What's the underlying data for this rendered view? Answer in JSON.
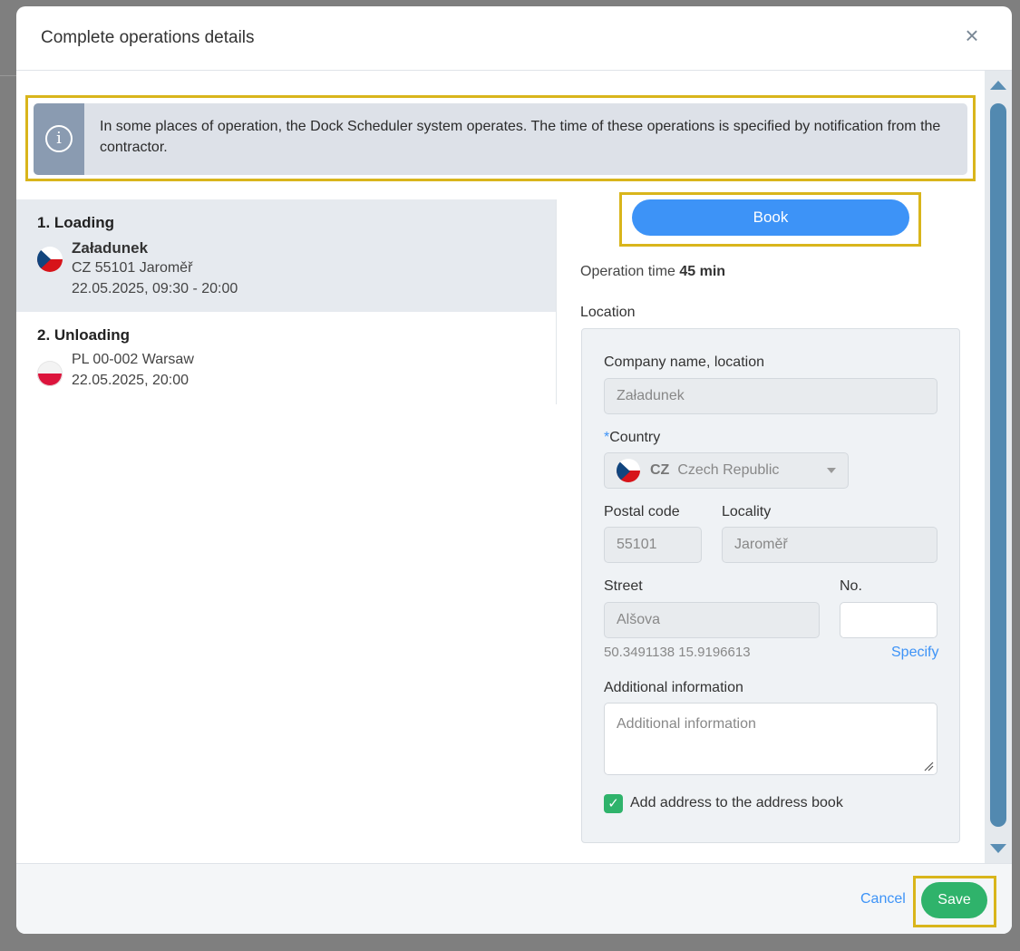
{
  "modal": {
    "title": "Complete operations details",
    "close_icon": "close-icon"
  },
  "info": {
    "icon": "info-icon",
    "icon_glyph": "i",
    "text": "In some places of operation, the Dock Scheduler system operates. The time of these operations is specified by notification from the contractor."
  },
  "operations": [
    {
      "title": "1. Loading",
      "flag": "cz-flag-icon",
      "company": "Załadunek",
      "address": "CZ 55101 Jaroměř",
      "time": "22.05.2025, 09:30 - 20:00",
      "selected": true
    },
    {
      "title": "2. Unloading",
      "flag": "pl-flag-icon",
      "company": "",
      "address": "PL 00-002 Warsaw",
      "time": "22.05.2025, 20:00",
      "selected": false
    }
  ],
  "book_label": "Book",
  "operation_time": {
    "label": "Operation time",
    "value": "45 min"
  },
  "location": {
    "label": "Location",
    "company": {
      "label": "Company name, location",
      "value": "Załadunek"
    },
    "country": {
      "required_mark": "*",
      "label": "Country",
      "code": "CZ",
      "name": "Czech Republic"
    },
    "postal": {
      "label": "Postal code",
      "value": "55101"
    },
    "locality": {
      "label": "Locality",
      "value": "Jaroměř"
    },
    "street": {
      "label": "Street",
      "value": "Alšova"
    },
    "number": {
      "label": "No.",
      "value": ""
    },
    "coords": "50.3491138 15.9196613",
    "specify": "Specify",
    "additional": {
      "label": "Additional information",
      "placeholder": "Additional information"
    },
    "address_book": {
      "label": "Add address to the address book",
      "checked": true,
      "check_glyph": "✓"
    }
  },
  "footer": {
    "cancel": "Cancel",
    "save": "Save"
  },
  "colors": {
    "accent_blue": "#3d93f7",
    "success_green": "#2fb36b",
    "highlight": "#d9b51b",
    "scroll": "#5289b0"
  }
}
